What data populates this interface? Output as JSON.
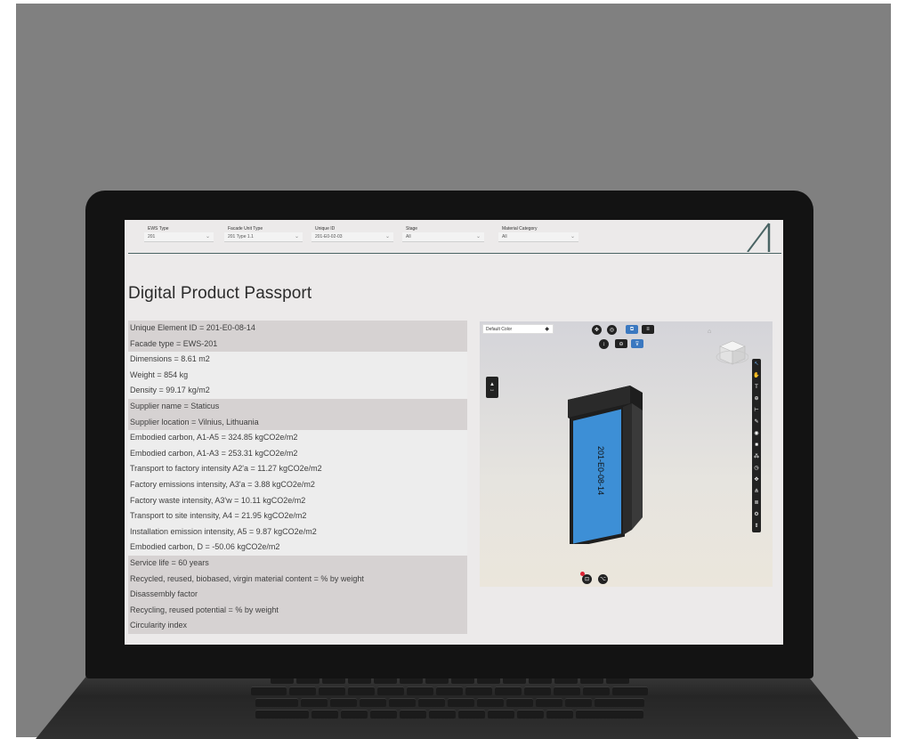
{
  "filters": [
    {
      "label": "EWS Type",
      "value": "201"
    },
    {
      "label": "Facade Unit Type",
      "value": "201 Type 1.1"
    },
    {
      "label": "Unique ID",
      "value": "201-E0-02-03"
    },
    {
      "label": "Stage",
      "value": "All"
    },
    {
      "label": "Material Category",
      "value": "All"
    }
  ],
  "page_title": "Digital Product Passport",
  "properties": [
    {
      "text": "Unique Element ID = 201-E0-08-14",
      "shade": true
    },
    {
      "text": "Facade type = EWS-201",
      "shade": true
    },
    {
      "text": "Dimensions = 8.61 m2",
      "shade": false
    },
    {
      "text": "Weight = 854 kg",
      "shade": false
    },
    {
      "text": "Density = 99.17 kg/m2",
      "shade": false
    },
    {
      "text": "Supplier name = Staticus",
      "shade": true
    },
    {
      "text": "Supplier location = Vilnius, Lithuania",
      "shade": true
    },
    {
      "text": "Embodied carbon, A1-A5 = 324.85 kgCO2e/m2",
      "shade": false
    },
    {
      "text": "Embodied carbon, A1-A3 = 253.31 kgCO2e/m2",
      "shade": false
    },
    {
      "text": "Transport to factory intensity A2'a = 11.27 kgCO2e/m2",
      "shade": false
    },
    {
      "text": "Factory emissions intensity, A3'a = 3.88 kgCO2e/m2",
      "shade": false
    },
    {
      "text": "Factory waste intensity, A3'w = 10.11 kgCO2e/m2",
      "shade": false
    },
    {
      "text": "Transport to site intensity, A4 = 21.95 kgCO2e/m2",
      "shade": false
    },
    {
      "text": "Installation emission intensity, A5 = 9.87 kgCO2e/m2",
      "shade": false
    },
    {
      "text": "Embodied carbon, D = -50.06 kgCO2e/m2",
      "shade": false
    },
    {
      "text": "Service life = 60 years",
      "shade": true
    },
    {
      "text": "Recycled, reused, biobased, virgin material content = % by weight",
      "shade": true
    },
    {
      "text": "Disassembly factor",
      "shade": true
    },
    {
      "text": "Recycling, reused potential = % by weight",
      "shade": true
    },
    {
      "text": "Circularity index",
      "shade": true
    }
  ],
  "viewer": {
    "color_mode": "Default Color",
    "element_label": "201-E0-08-14",
    "toolbar_icons": [
      "pan-icon",
      "orbit-icon",
      "select-icon",
      "list-icon",
      "zoom-icon",
      "section-icon",
      "filter-icon"
    ],
    "side_tools": [
      "cursor-icon",
      "hand-icon",
      "text-icon",
      "pin-icon",
      "measure-icon",
      "pencil-icon",
      "paint-icon",
      "box-icon",
      "cluster-icon",
      "clock-icon",
      "move-icon",
      "tree-icon",
      "layers-icon",
      "settings-icon",
      "updown-icon"
    ],
    "colors": {
      "glass": "#3d8fd6",
      "frame": "#1e1e1e"
    }
  }
}
